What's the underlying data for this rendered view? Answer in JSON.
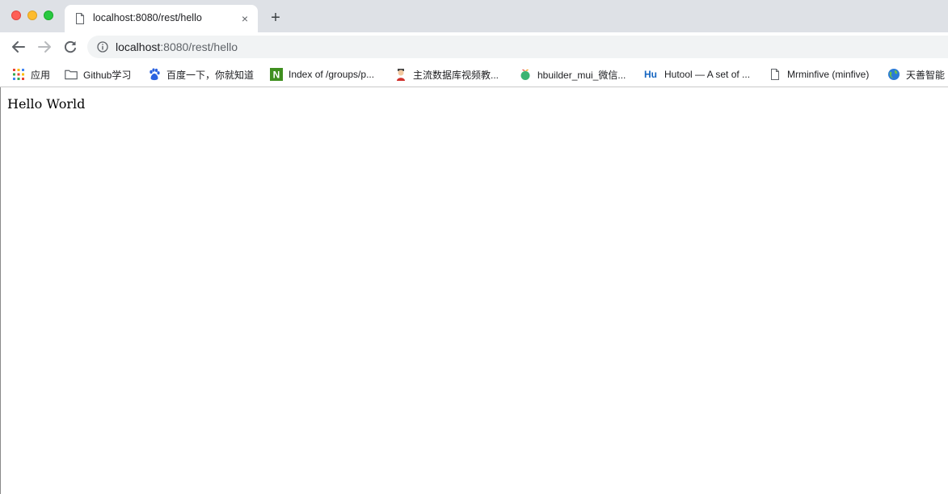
{
  "window": {
    "traffic_lights": [
      "close",
      "minimize",
      "zoom"
    ]
  },
  "tabs": [
    {
      "title": "localhost:8080/rest/hello",
      "icon": "document-icon",
      "close_label": "×"
    }
  ],
  "new_tab_label": "+",
  "toolbar": {
    "back_icon": "arrow-left-icon",
    "forward_icon": "arrow-right-icon",
    "reload_icon": "reload-icon",
    "site_info_icon": "info-icon",
    "url_host": "localhost",
    "url_rest": ":8080/rest/hello"
  },
  "bookmarks": [
    {
      "label": "应用",
      "icon": "apps-grid-icon"
    },
    {
      "label": "Github学习",
      "icon": "folder-icon"
    },
    {
      "label": "百度一下，你就知道",
      "icon": "baidu-paw-icon"
    },
    {
      "label": "Index of /groups/p...",
      "icon": "nexus-n-icon"
    },
    {
      "label": "主流数据库视频教...",
      "icon": "avatar-icon"
    },
    {
      "label": "hbuilder_mui_微信...",
      "icon": "fruit-icon"
    },
    {
      "label": "Hutool — A set of ...",
      "icon": "hu-logo-icon",
      "icon_text": "Hu"
    },
    {
      "label": "Mrminfive (minfive)",
      "icon": "document-icon"
    },
    {
      "label": "天善智能",
      "icon": "globe-icon"
    }
  ],
  "page": {
    "body_text": "Hello World"
  },
  "colors": {
    "tabstrip_bg": "#dee1e6",
    "omnibox_bg": "#f1f3f4",
    "traffic_red": "#fe5f57",
    "traffic_yellow": "#febc2e",
    "traffic_green": "#28c840"
  }
}
